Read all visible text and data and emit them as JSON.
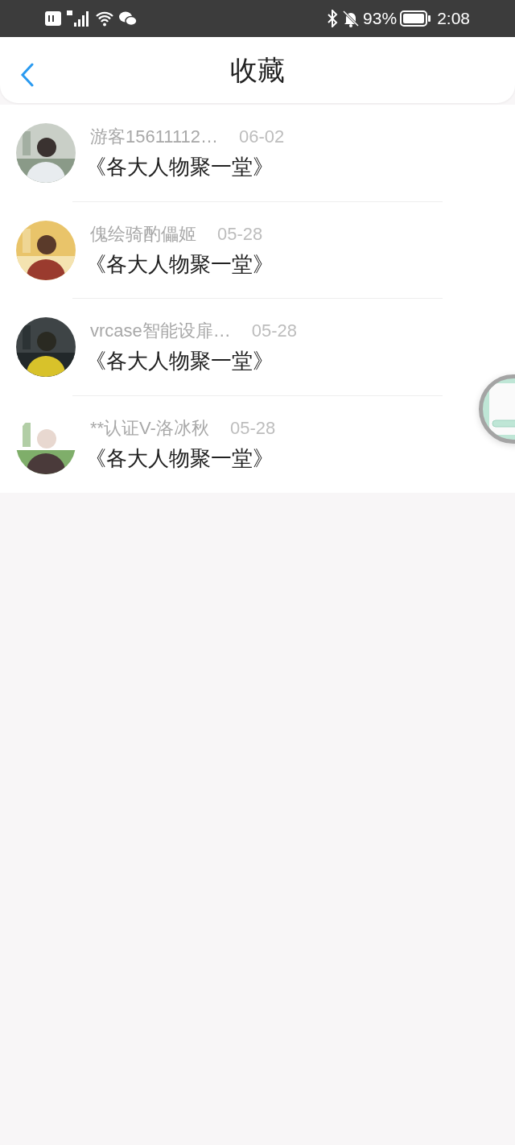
{
  "status_bar": {
    "battery": "93%",
    "time": "2:08"
  },
  "header": {
    "title": "收藏"
  },
  "items": [
    {
      "user": "游客15611112…",
      "date": "06-02",
      "title": "《各大人物聚一堂》"
    },
    {
      "user": "傀绘骑酌儡姬",
      "date": "05-28",
      "title": "《各大人物聚一堂》"
    },
    {
      "user": "vrcase智能设扉…",
      "date": "05-28",
      "title": "《各大人物聚一堂》"
    },
    {
      "user": "**认证V-洛冰秋",
      "date": "05-28",
      "title": "《各大人物聚一堂》"
    }
  ]
}
